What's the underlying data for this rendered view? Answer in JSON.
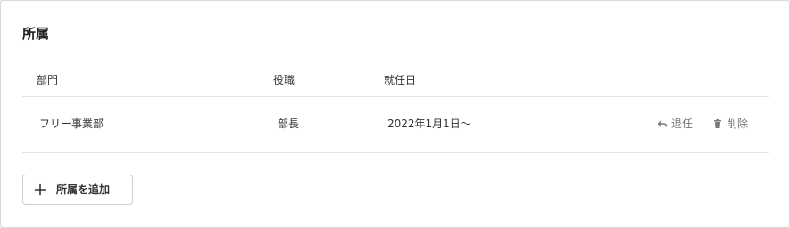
{
  "section": {
    "title": "所属"
  },
  "table": {
    "headers": {
      "department": "部門",
      "position": "役職",
      "start_date": "就任日"
    },
    "rows": [
      {
        "department": "フリー事業部",
        "position": "部長",
        "start_date": "2022年1月1日〜",
        "actions": {
          "resign_label": "退任",
          "resign_icon": "undo-icon",
          "delete_label": "削除",
          "delete_icon": "trash-icon"
        }
      }
    ]
  },
  "add_button": {
    "label": "所属を追加",
    "icon": "plus-icon"
  },
  "colors": {
    "text": "#333333",
    "muted": "#777777",
    "border": "#e3e3e3",
    "background": "#f2f2f2"
  }
}
